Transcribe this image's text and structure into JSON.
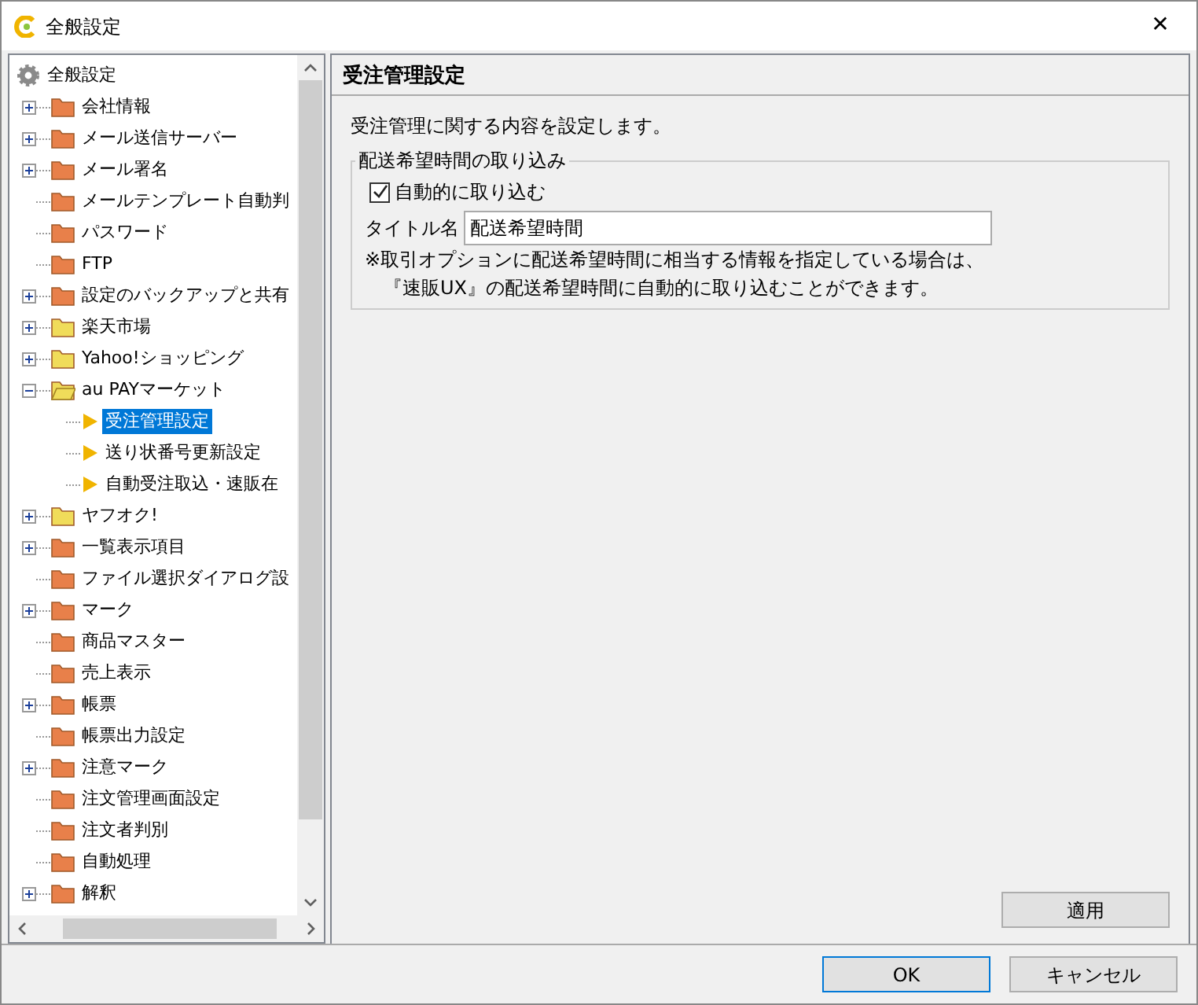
{
  "window": {
    "title": "全般設定",
    "close": "✕"
  },
  "tree": {
    "label": "全般設定",
    "children": [
      {
        "label": "会社情報",
        "kind": "folder",
        "color": "#e8804a",
        "expanded": false
      },
      {
        "label": "メール送信サーバー",
        "kind": "folder",
        "color": "#e8804a",
        "expanded": false
      },
      {
        "label": "メール署名",
        "kind": "folder",
        "color": "#e8804a",
        "expanded": false
      },
      {
        "label": "メールテンプレート自動判",
        "kind": "folder",
        "color": "#e8804a"
      },
      {
        "label": "パスワード",
        "kind": "folder",
        "color": "#e8804a"
      },
      {
        "label": "FTP",
        "kind": "folder",
        "color": "#e8804a"
      },
      {
        "label": "設定のバックアップと共有",
        "kind": "folder",
        "color": "#e8804a",
        "expanded": false
      },
      {
        "label": "楽天市場",
        "kind": "folder",
        "color": "#f0dc5a",
        "expanded": false
      },
      {
        "label": "Yahoo!ショッピング",
        "kind": "folder",
        "color": "#f0dc5a",
        "expanded": false
      },
      {
        "label": "au PAYマーケット",
        "kind": "folder",
        "color": "#f0dc5a",
        "expanded": true,
        "children": [
          {
            "label": "受注管理設定",
            "kind": "page",
            "selected": true
          },
          {
            "label": "送り状番号更新設定",
            "kind": "page",
            "selected": false
          },
          {
            "label": "自動受注取込・速販在",
            "kind": "page",
            "selected": false
          }
        ]
      },
      {
        "label": "ヤフオク!",
        "kind": "folder",
        "color": "#f0dc5a",
        "expanded": false
      },
      {
        "label": "一覧表示項目",
        "kind": "folder",
        "color": "#e8804a",
        "expanded": false
      },
      {
        "label": "ファイル選択ダイアログ設",
        "kind": "folder",
        "color": "#e8804a"
      },
      {
        "label": "マーク",
        "kind": "folder",
        "color": "#e8804a",
        "expanded": false
      },
      {
        "label": "商品マスター",
        "kind": "folder",
        "color": "#e8804a"
      },
      {
        "label": "売上表示",
        "kind": "folder",
        "color": "#e8804a"
      },
      {
        "label": "帳票",
        "kind": "folder",
        "color": "#e8804a",
        "expanded": false
      },
      {
        "label": "帳票出力設定",
        "kind": "folder",
        "color": "#e8804a"
      },
      {
        "label": "注意マーク",
        "kind": "folder",
        "color": "#e8804a",
        "expanded": false
      },
      {
        "label": "注文管理画面設定",
        "kind": "folder",
        "color": "#e8804a"
      },
      {
        "label": "注文者判別",
        "kind": "folder",
        "color": "#e8804a"
      },
      {
        "label": "自動処理",
        "kind": "folder",
        "color": "#e8804a"
      },
      {
        "label": "解釈",
        "kind": "folder",
        "color": "#e8804a",
        "expanded": false
      }
    ]
  },
  "panel": {
    "title": "受注管理設定",
    "description": "受注管理に関する内容を設定します。",
    "group": {
      "legend": "配送希望時間の取り込み",
      "checkbox": {
        "label": "自動的に取り込む",
        "checked": true
      },
      "field": {
        "label": "タイトル名",
        "value": "配送希望時間"
      },
      "notes": [
        "※取引オプションに配送希望時間に相当する情報を指定している場合は、",
        "『速販UX』の配送希望時間に自動的に取り込むことができます。"
      ]
    },
    "apply": "適用"
  },
  "buttons": [
    {
      "label": "OK",
      "default": true
    },
    {
      "label": "キャンセル",
      "default": false
    }
  ]
}
